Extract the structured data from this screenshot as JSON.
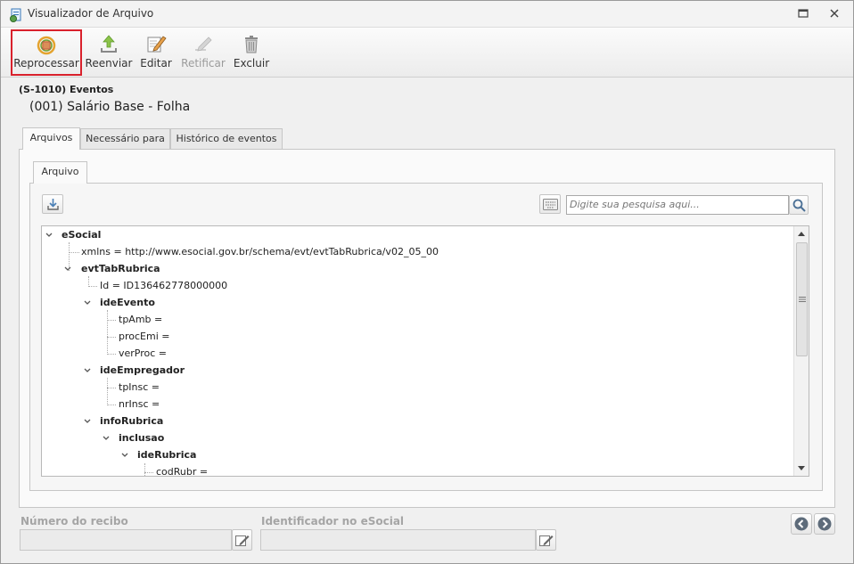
{
  "window": {
    "title": "Visualizador de Arquivo"
  },
  "toolbar": {
    "buttons": [
      {
        "label": "Reprocessar",
        "icon": "reprocess-icon",
        "enabled": true,
        "selected": true
      },
      {
        "label": "Reenviar",
        "icon": "upload-icon",
        "enabled": true
      },
      {
        "label": "Editar",
        "icon": "edit-icon",
        "enabled": true
      },
      {
        "label": "Retificar",
        "icon": "rectify-icon",
        "enabled": false
      },
      {
        "label": "Excluir",
        "icon": "trash-icon",
        "enabled": true
      }
    ]
  },
  "record": {
    "title": "(S-1010) Eventos",
    "subtitle": "(001) Salário Base - Folha"
  },
  "tabs": [
    "Arquivos",
    "Necessário para",
    "Histórico de eventos"
  ],
  "inner_tab": "Arquivo",
  "search": {
    "placeholder": "Digite sua pesquisa aqui..."
  },
  "tree": [
    {
      "text": "eSocial",
      "bold": true,
      "expanded": true
    },
    {
      "text": "xmlns = http://www.esocial.gov.br/schema/evt/evtTabRubrica/v02_05_00",
      "bold": false
    },
    {
      "text": "evtTabRubrica",
      "bold": true,
      "expanded": true
    },
    {
      "text": "Id = ID136462778000000",
      "bold": false
    },
    {
      "text": "ideEvento",
      "bold": true,
      "expanded": true
    },
    {
      "text": "tpAmb =",
      "bold": false
    },
    {
      "text": "procEmi =",
      "bold": false
    },
    {
      "text": "verProc =",
      "bold": false
    },
    {
      "text": "ideEmpregador",
      "bold": true,
      "expanded": true
    },
    {
      "text": "tpInsc =",
      "bold": false
    },
    {
      "text": "nrInsc =",
      "bold": false
    },
    {
      "text": "infoRubrica",
      "bold": true,
      "expanded": true
    },
    {
      "text": "inclusao",
      "bold": true,
      "expanded": true
    },
    {
      "text": "ideRubrica",
      "bold": true,
      "expanded": true
    },
    {
      "text": "codRubr =",
      "bold": false
    }
  ],
  "footer": {
    "receipt_label": "Número do recibo",
    "receipt_value": "",
    "esocial_id_label": "Identificador no eSocial",
    "esocial_id_value": ""
  },
  "colors": {
    "selection_border": "#d9212c",
    "disabled_text": "#9b9b9b"
  }
}
